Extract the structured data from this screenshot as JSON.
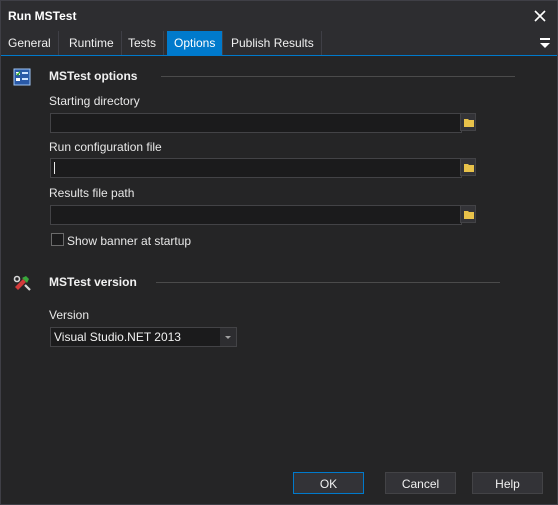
{
  "window": {
    "title": "Run MSTest"
  },
  "tabs": [
    {
      "label": "General"
    },
    {
      "label": "Runtime"
    },
    {
      "label": "Tests"
    },
    {
      "label": "Options",
      "active": true
    },
    {
      "label": "Publish Results"
    }
  ],
  "options_section": {
    "header": "MSTest options",
    "starting_directory": {
      "label": "Starting directory",
      "value": ""
    },
    "run_config_file": {
      "label": "Run configuration file",
      "value": ""
    },
    "results_file_path": {
      "label": "Results file path",
      "value": ""
    },
    "show_banner": {
      "label": "Show banner at startup",
      "checked": false
    }
  },
  "version_section": {
    "header": "MSTest version",
    "version_label": "Version",
    "version_value": "Visual Studio.NET 2013"
  },
  "footer": {
    "ok_label": "OK",
    "cancel_label": "Cancel",
    "help_label": "Help"
  },
  "colors": {
    "accent": "#007acc",
    "background": "#252526",
    "titlebar": "#2d2d30"
  },
  "icons": {
    "options_section_icon": "checklist-icon",
    "version_section_icon": "tools-icon",
    "browse_icon": "folder-icon",
    "tab_menu_icon": "dropdown-menu-icon"
  }
}
